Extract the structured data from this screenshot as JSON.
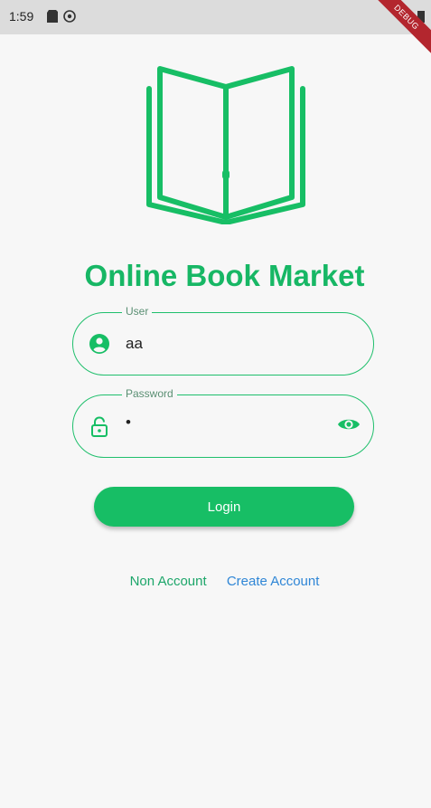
{
  "status_bar": {
    "time": "1:59"
  },
  "debug_banner": "DEBUG",
  "app": {
    "title": "Online Book Market",
    "logo_icon": "open-book-icon",
    "accent_color": "#17be65"
  },
  "form": {
    "user": {
      "label": "User",
      "value": "aa",
      "icon": "account-circle-icon"
    },
    "password": {
      "label": "Password",
      "value": "•",
      "icon": "lock-icon",
      "toggle_icon": "eye-icon"
    },
    "login_label": "Login"
  },
  "footer": {
    "non_account": "Non Account",
    "create_account": "Create Account"
  }
}
